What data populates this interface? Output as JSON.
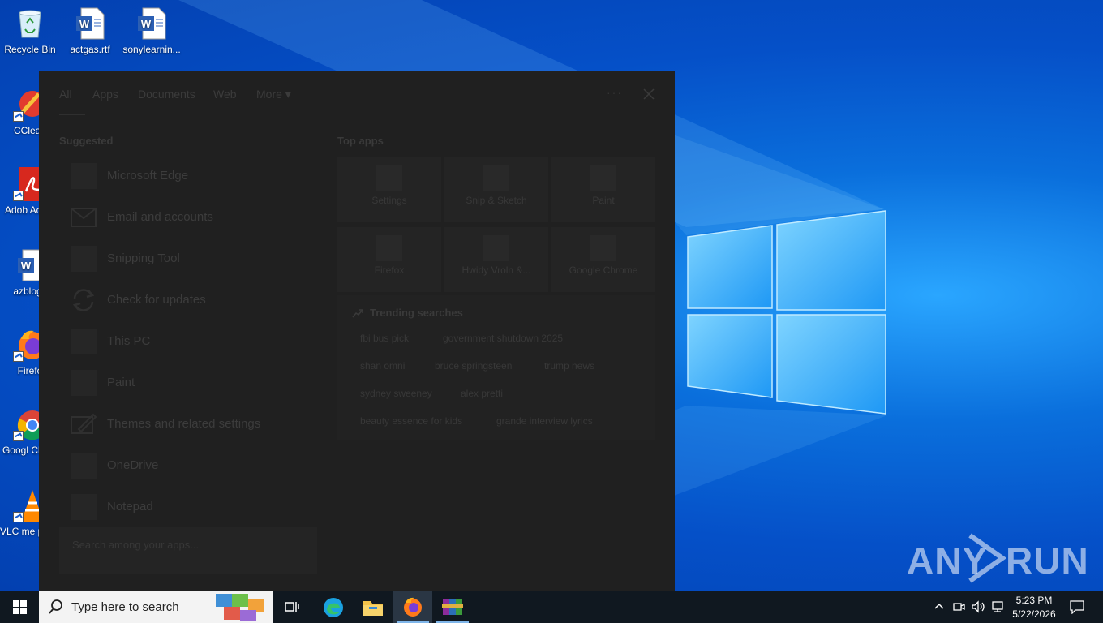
{
  "desktop": {
    "icons": [
      {
        "label": "Recycle Bin"
      },
      {
        "label": "actgas.rtf"
      },
      {
        "label": "sonylearnin..."
      },
      {
        "label": "CClean"
      },
      {
        "label": "Adob Acrob"
      },
      {
        "label": "azblogs"
      },
      {
        "label": "Firefo"
      },
      {
        "label": "Googl Chron"
      },
      {
        "label": "VLC me playe"
      }
    ],
    "watermark": {
      "left": "ANY",
      "right": "RUN"
    }
  },
  "search_panel": {
    "tabs": [
      {
        "label": "All"
      },
      {
        "label": "Apps"
      },
      {
        "label": "Documents"
      },
      {
        "label": "Web"
      },
      {
        "label": "More ▾"
      }
    ],
    "suggested_title": "Suggested",
    "suggested": [
      {
        "label": "Microsoft Edge"
      },
      {
        "label": "Email and accounts"
      },
      {
        "label": "Snipping Tool"
      },
      {
        "label": "Check for updates"
      },
      {
        "label": "This PC"
      },
      {
        "label": "Paint"
      },
      {
        "label": "Themes and related settings"
      },
      {
        "label": "OneDrive"
      },
      {
        "label": "Notepad"
      }
    ],
    "top_apps_title": "Top apps",
    "top_apps": [
      {
        "label": "Settings"
      },
      {
        "label": "Snip & Sketch"
      },
      {
        "label": "Paint"
      },
      {
        "label": "Firefox"
      },
      {
        "label": "Hwidy Vroln &..."
      },
      {
        "label": "Google Chrome"
      }
    ],
    "trending_title": "Trending searches",
    "trending": [
      {
        "label": "fbi bus pick"
      },
      {
        "label": "government shutdown 2025"
      },
      {
        "label": "shan omni"
      },
      {
        "label": "bruce springsteen"
      },
      {
        "label": "trump news"
      },
      {
        "label": "sydney sweeney"
      },
      {
        "label": "alex pretti"
      },
      {
        "label": "beauty essence for kids"
      },
      {
        "label": "grande interview lyrics"
      }
    ],
    "hint_text": "Search among your apps..."
  },
  "taskbar": {
    "search_placeholder": "Type here to search",
    "time": "5:23 PM",
    "date": "5/22/2026"
  },
  "colors": {
    "accent": "#0a6fdc",
    "panel_bg": "#202020",
    "taskbar_bg": "#101820"
  }
}
